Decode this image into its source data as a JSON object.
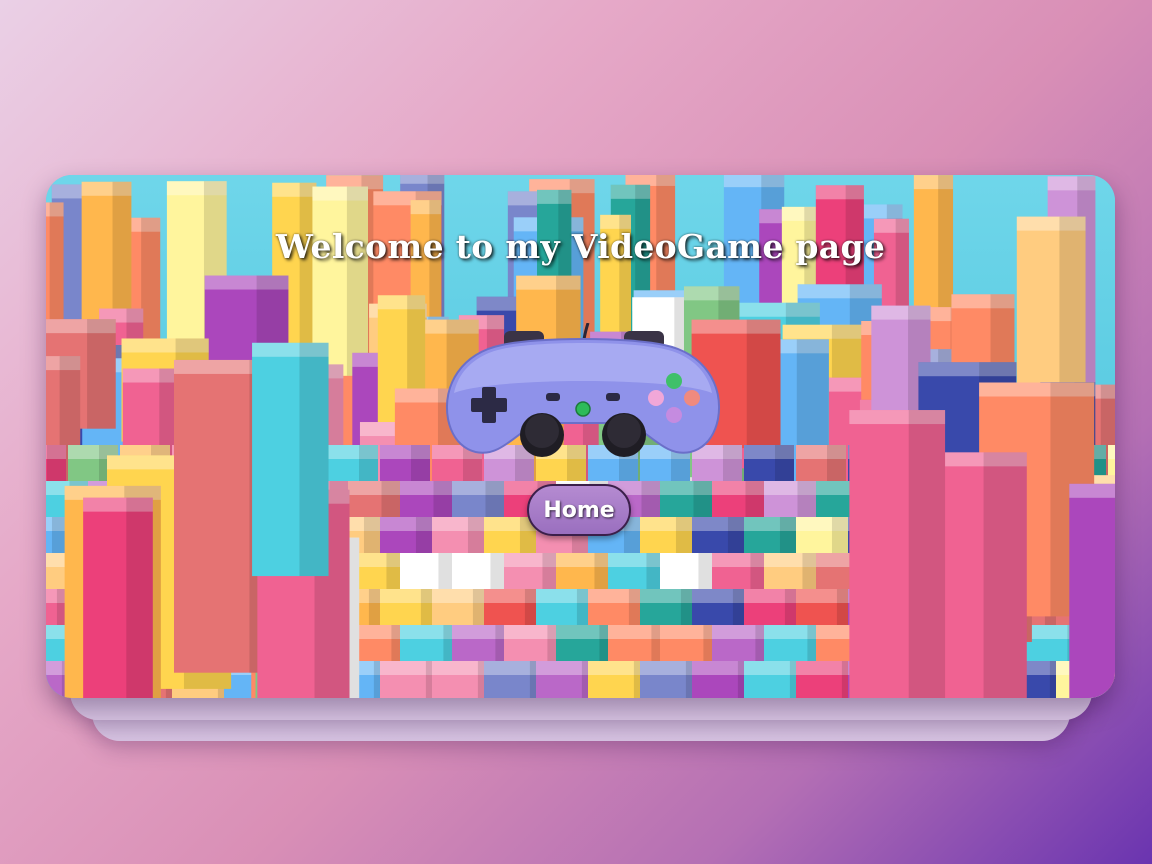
{
  "page": {
    "title": "Welcome to my VideoGame page"
  },
  "nav": {
    "home_label": "Home"
  },
  "icons": {
    "hero_image": "colorful-blocks-city-image",
    "controller": "gamepad-icon"
  },
  "colors": {
    "title_text": "#ffffff",
    "button_fill": "#a77cc6",
    "button_border": "#3b1f4a",
    "controller_body": "#8f92ea",
    "page_gradient_start": "#ead0e6",
    "page_gradient_end": "#6a34b0"
  }
}
